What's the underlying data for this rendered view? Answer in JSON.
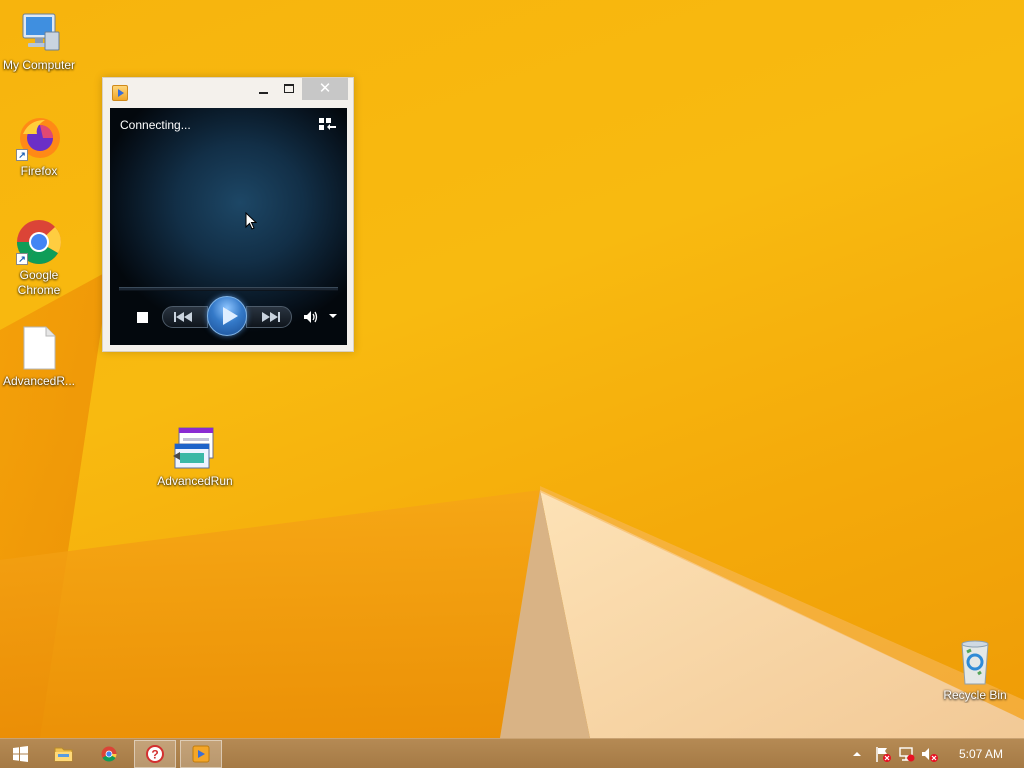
{
  "desktop": {
    "icons": [
      {
        "label": "My Computer",
        "icon": "computer-icon"
      },
      {
        "label": "Firefox",
        "icon": "firefox-icon"
      },
      {
        "label": "Google Chrome",
        "icon": "chrome-icon"
      },
      {
        "label": "AdvancedR...",
        "icon": "document-icon"
      },
      {
        "label": "AdvancedRun",
        "icon": "advancedrun-icon"
      },
      {
        "label": "Recycle Bin",
        "icon": "recycle-bin-icon"
      }
    ]
  },
  "media_player": {
    "status": "Connecting...",
    "close_glyph": "✕",
    "icon": "windows-media-player-icon"
  },
  "taskbar": {
    "items": [
      "start-icon",
      "file-explorer-icon",
      "chrome-icon",
      "help-icon",
      "windows-media-player-icon"
    ],
    "tray": [
      "show-hidden-icons-icon",
      "action-center-flag-icon",
      "network-icon",
      "volume-muted-icon"
    ],
    "clock": "5:07 AM"
  },
  "colors": {
    "wallpaper": "#f7b40d",
    "taskbar": "#a87d48",
    "accent": "#3479c8"
  }
}
